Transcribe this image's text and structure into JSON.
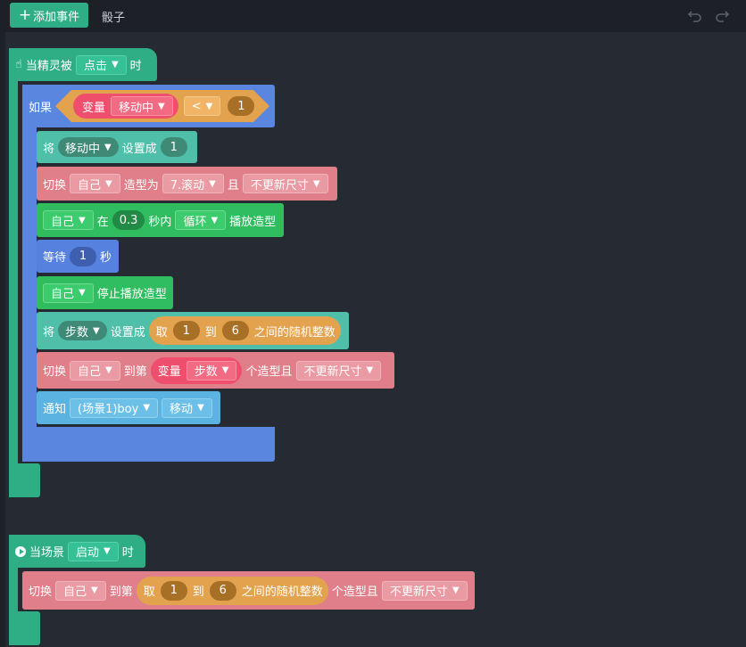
{
  "toolbar": {
    "add_event_label": "添加事件",
    "tab_name": "骰子"
  },
  "icons": {
    "plus": "plus-icon",
    "undo": "undo-icon",
    "redo": "redo-icon",
    "hand": "hand-pointer-icon",
    "play": "play-circle-icon",
    "dropdown": "▼"
  },
  "colors": {
    "event": "#2fae86",
    "control": "#5b86e0",
    "variable": "#4fbfaa",
    "looks": "#e07f8a",
    "sound": "#2fbd5f",
    "message": "#5ab3e0",
    "operator": "#e2a24e",
    "reporter": "#ef4f6c"
  },
  "script1": {
    "hat": {
      "prefix": "当精灵被",
      "trigger": "点击",
      "suffix": "时"
    },
    "if": {
      "label": "如果",
      "var_label": "变量",
      "var_name": "移动中",
      "operator": "<",
      "value": "1"
    },
    "b1": {
      "label": "将",
      "var": "移动中",
      "action": "设置成",
      "value": "1"
    },
    "b2": {
      "label": "切换",
      "target": "自己",
      "mid": "造型为",
      "costume": "7.滚动",
      "and": "且",
      "mode": "不更新尺寸"
    },
    "b3": {
      "target": "自己",
      "in_label": "在",
      "seconds": "0.3",
      "sec_label": "秒内",
      "loop": "循环",
      "action": "播放造型"
    },
    "b4": {
      "label": "等待",
      "value": "1",
      "unit": "秒"
    },
    "b5": {
      "target": "自己",
      "action": "停止播放造型"
    },
    "b6": {
      "label": "将",
      "var": "步数",
      "action": "设置成",
      "rand_label": "取",
      "from": "1",
      "to_label": "到",
      "to": "6",
      "rand_suffix": "之间的随机整数"
    },
    "b7": {
      "label": "切换",
      "target": "自己",
      "mid": "到第",
      "var_label": "变量",
      "var_name": "步数",
      "suffix": "个造型且",
      "mode": "不更新尺寸"
    },
    "b8": {
      "label": "通知",
      "target": "(场景1)boy",
      "message": "移动"
    }
  },
  "script2": {
    "hat": {
      "prefix": "当场景",
      "trigger": "启动",
      "suffix": "时"
    },
    "b1": {
      "label": "切换",
      "target": "自己",
      "mid": "到第",
      "rand_label": "取",
      "from": "1",
      "to_label": "到",
      "to": "6",
      "rand_suffix": "之间的随机整数",
      "suffix": "个造型且",
      "mode": "不更新尺寸"
    }
  }
}
